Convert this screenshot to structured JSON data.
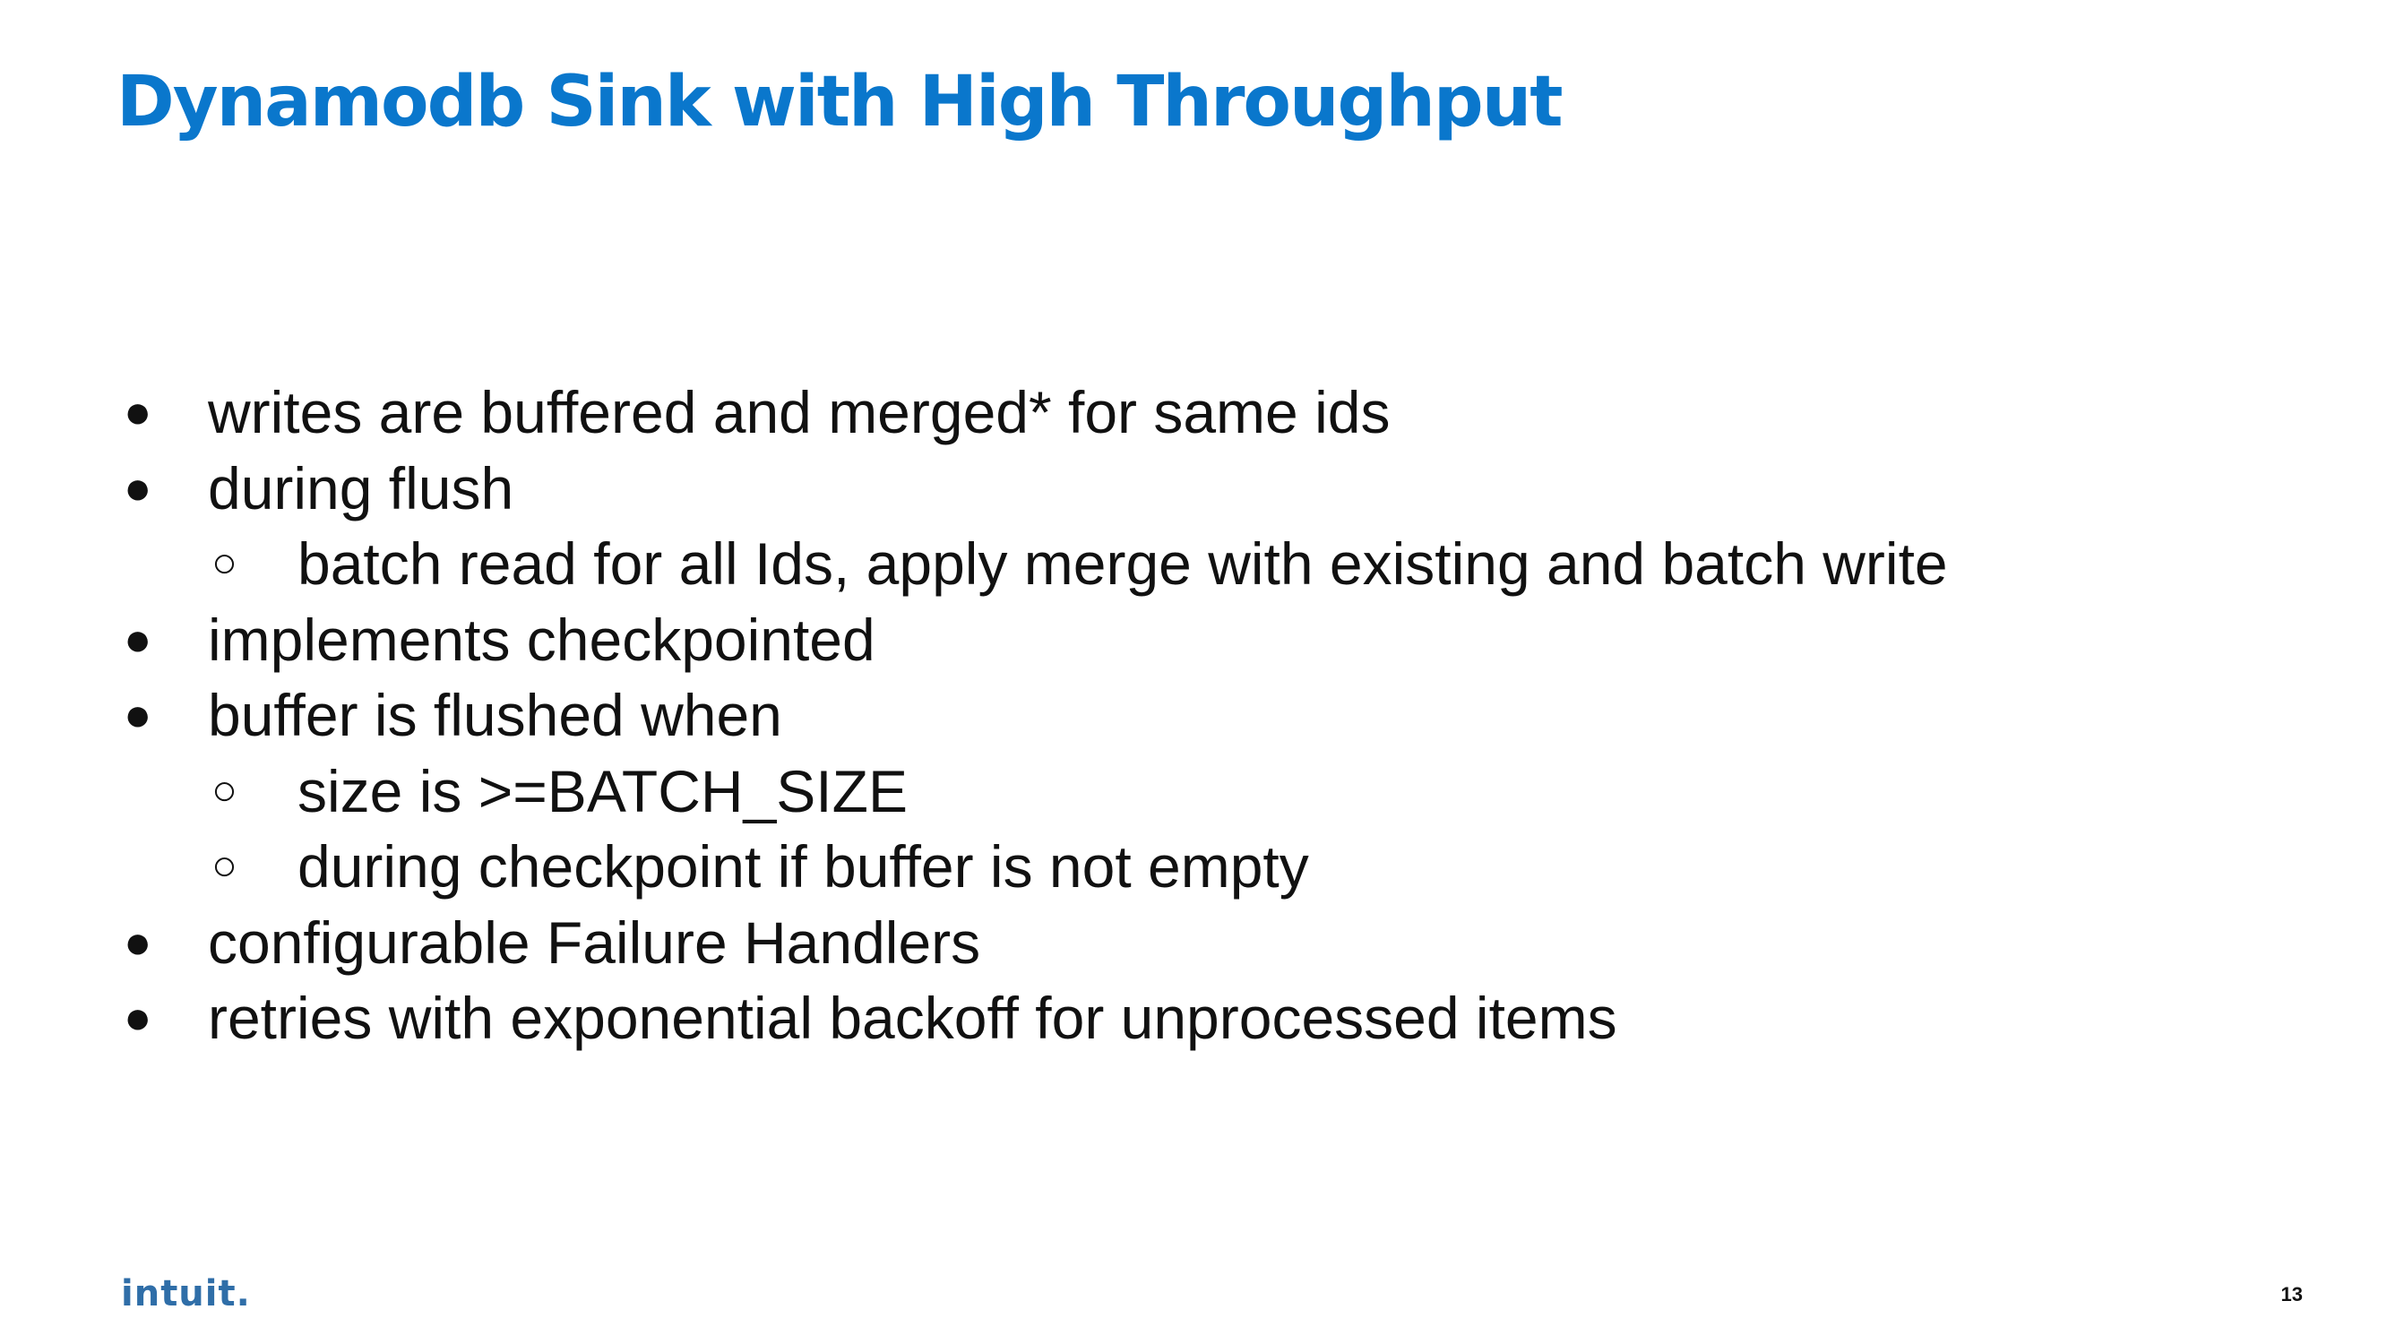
{
  "slide": {
    "title": "Dynamodb Sink with High Throughput",
    "accent_color": "#0a77cc",
    "bullet_glyphs": {
      "level1": "●",
      "level2": "○"
    },
    "bullets": [
      {
        "level": 1,
        "text": "writes are buffered and merged* for same ids"
      },
      {
        "level": 1,
        "text": "during flush"
      },
      {
        "level": 2,
        "text": "batch read for all Ids, apply merge with existing and batch write"
      },
      {
        "level": 1,
        "text": "implements checkpointed"
      },
      {
        "level": 1,
        "text": "buffer is flushed when"
      },
      {
        "level": 2,
        "text": "size is >=BATCH_SIZE"
      },
      {
        "level": 2,
        "text": "during checkpoint if buffer is not empty"
      },
      {
        "level": 1,
        "text": "configurable Failure Handlers"
      },
      {
        "level": 1,
        "text": "retries with exponential backoff for unprocessed items"
      }
    ],
    "footer": {
      "logo_text": "intuit.",
      "page_number": "13"
    }
  }
}
